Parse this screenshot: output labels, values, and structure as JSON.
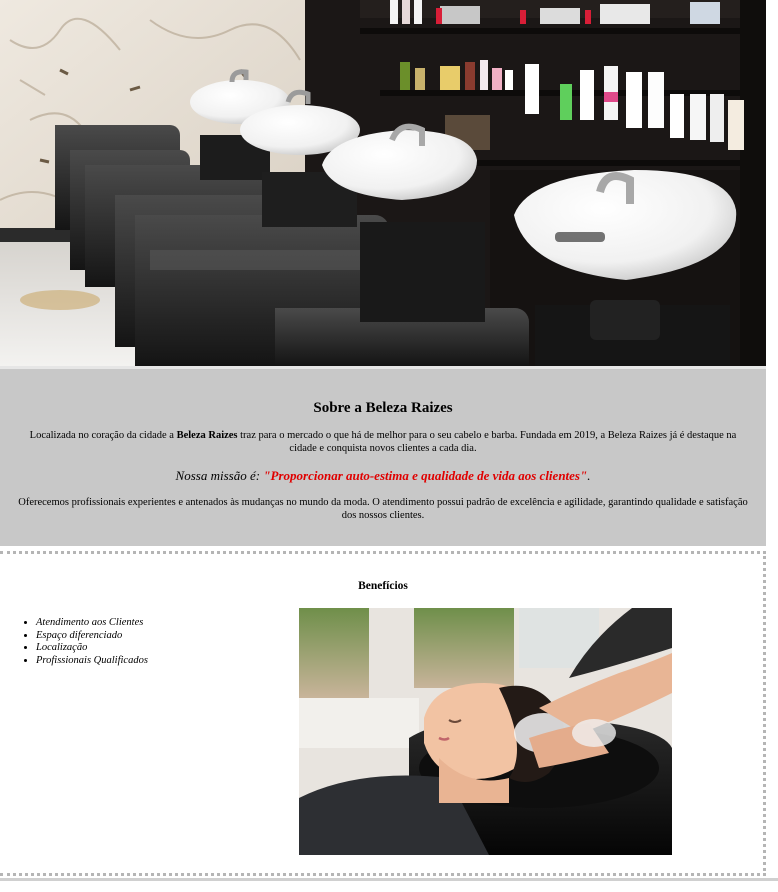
{
  "hero": {
    "image": "salon-wash-stations-photo"
  },
  "about": {
    "title": "Sobre a Beleza Raizes",
    "intro_before": "Localizada no coração da cidade a ",
    "intro_brand": "Beleza Raizes",
    "intro_after": " traz para o mercado o que há de melhor para o seu cabelo e barba. Fundada em 2019, a Beleza Raizes já é destaque na cidade e conquista novos clientes a cada dia.",
    "mission_label": "Nossa missão é: ",
    "mission_quote": "\"Proporcionar auto-estima e qualidade de vida aos clientes\"",
    "mission_end": ".",
    "offer": "Oferecemos profissionais experientes e antenados às mudanças no mundo da moda. O atendimento possui padrão de excelência e agilidade, garantindo qualidade e satisfação dos nossos clientes."
  },
  "benefits": {
    "title": "Benefícios",
    "items": [
      "Atendimento aos Clientes",
      "Espaço diferenciado",
      "Localização",
      "Profissionais Qualificados"
    ],
    "image": "hair-wash-photo"
  },
  "colors": {
    "section_bg": "#c8c8c8",
    "mission_accent": "#e00000",
    "border": "#b5b5b5"
  }
}
